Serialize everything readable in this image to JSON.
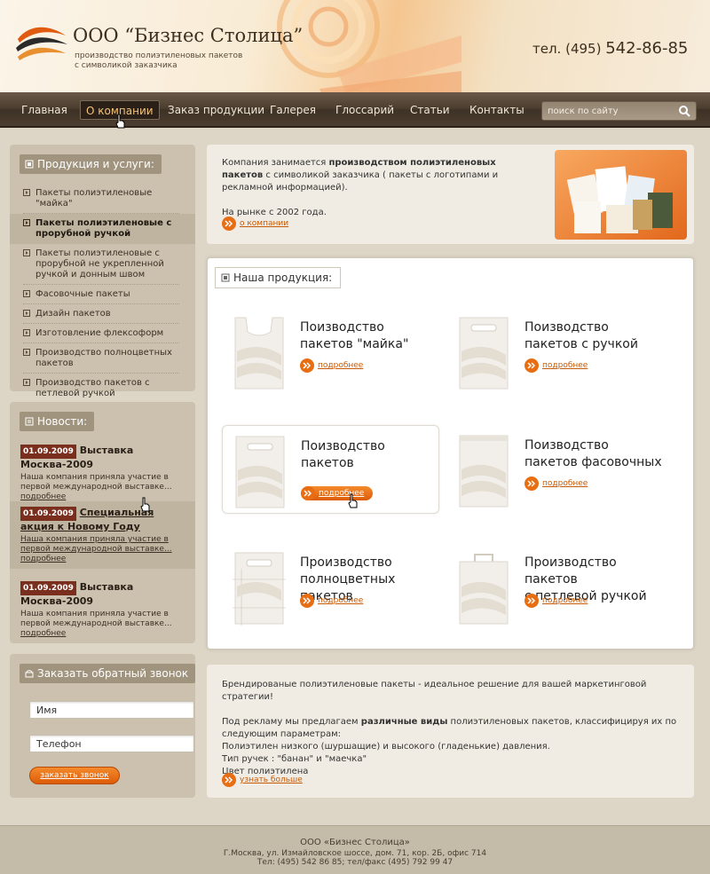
{
  "header": {
    "company": "ООО “Бизнес Столица”",
    "tagline_line1": "производство полиэтиленовых пакетов",
    "tagline_line2": "с символикой заказчика",
    "phone_prefix": "тел. (495)",
    "phone_number": "542-86-85"
  },
  "nav": {
    "items": [
      "Главная",
      "О компании",
      "Заказ продукции",
      "Галерея",
      "Глоссарий",
      "Статьи",
      "Контакты"
    ],
    "search_placeholder": "поиск по сайту"
  },
  "sidebar": {
    "products": {
      "title": "Продукция и услуги:",
      "items": [
        "Пакеты полиэтиленовые \"майка\"",
        "Пакеты полиэтиленовые с прорубной ручкой",
        "Пакеты полиэтиленовые с прорубной не укрепленной ручкой и донным швом",
        "Фасовочные пакеты",
        "Дизайн пакетов",
        "Изготовление флексоформ",
        "Производство полноцветных пакетов",
        "Производство пакетов с петлевой ручкой"
      ]
    },
    "news": {
      "title": "Новости:",
      "items": [
        {
          "date": "01.09.2009",
          "title": "Выставка Москва-2009",
          "text": "Наша компания приняла участие в первой международной выставке...",
          "more": "подробнее"
        },
        {
          "date": "01.09.2009",
          "title": "Специальная акция к Новому Году",
          "text": "Наша компания приняла участие в первой международной выставке...",
          "more": "подробнее"
        },
        {
          "date": "01.09.2009",
          "title": "Выставка Москва-2009",
          "text": "Наша компания приняла участие в первой международной выставке...",
          "more": "подробнее"
        }
      ]
    },
    "callback": {
      "title": "Заказать обратный звонок",
      "name_placeholder": "Имя",
      "phone_placeholder": "Телефон",
      "button": "заказать звонок"
    }
  },
  "intro": {
    "text_before": "Компания занимается ",
    "text_bold": "производством полиэтиленовых пакетов",
    "text_after": " с символикой заказчика ( пакеты с логотипами и рекламной информацией).",
    "since": "На рынке с 2002 года.",
    "link": "о компании"
  },
  "products": {
    "title": "Наша продукция:",
    "items": [
      {
        "line1": "Поизводство",
        "line2": "пакетов \"майка\"",
        "more": "подробнее"
      },
      {
        "line1": "Поизводство",
        "line2": "пакетов с ручкой",
        "more": "подробнее"
      },
      {
        "line1": "Поизводство",
        "line2": "пакетов",
        "more": "подробнее"
      },
      {
        "line1": "Поизводство",
        "line2": "пакетов фасовочных",
        "more": "подробнее"
      },
      {
        "line1": "Производство",
        "line2": "полноцветных пакетов",
        "more": "подробнее"
      },
      {
        "line1": "Производство пакетов",
        "line2": "с петлевой ручкой",
        "more": "подробнее"
      }
    ]
  },
  "description": {
    "p1": "Брендированые полиэтиленовые пакеты - идеальное решение для вашей маркетинговой стратегии!",
    "p2_before": "Под рекламу мы предлагаем ",
    "p2_bold": "различные виды",
    "p2_after": " полиэтиленовых пакетов, классифицируя их по следующим параметрам:",
    "p3": "Полиэтилен низкого (шуршащие) и высокого (гладенькие) давления.",
    "p4": "Тип ручек : \"банан\" и \"маечка\"",
    "p5": "Цвет полиэтилена",
    "link": "узнать больше"
  },
  "footer": {
    "company": "ООО «Бизнес Столица»",
    "address": "Г.Москва, ул. Измайловское шоссе, дом. 71, кор. 2Б, офис 714",
    "phones": "Тел: (495) 542 86 85; тел/факс (495) 792 99 47"
  },
  "colors": {
    "accent": "#e86e14",
    "nav_dark": "#4b3d2f",
    "panel": "#cbc1ae",
    "news_date": "#7a2e1e"
  }
}
